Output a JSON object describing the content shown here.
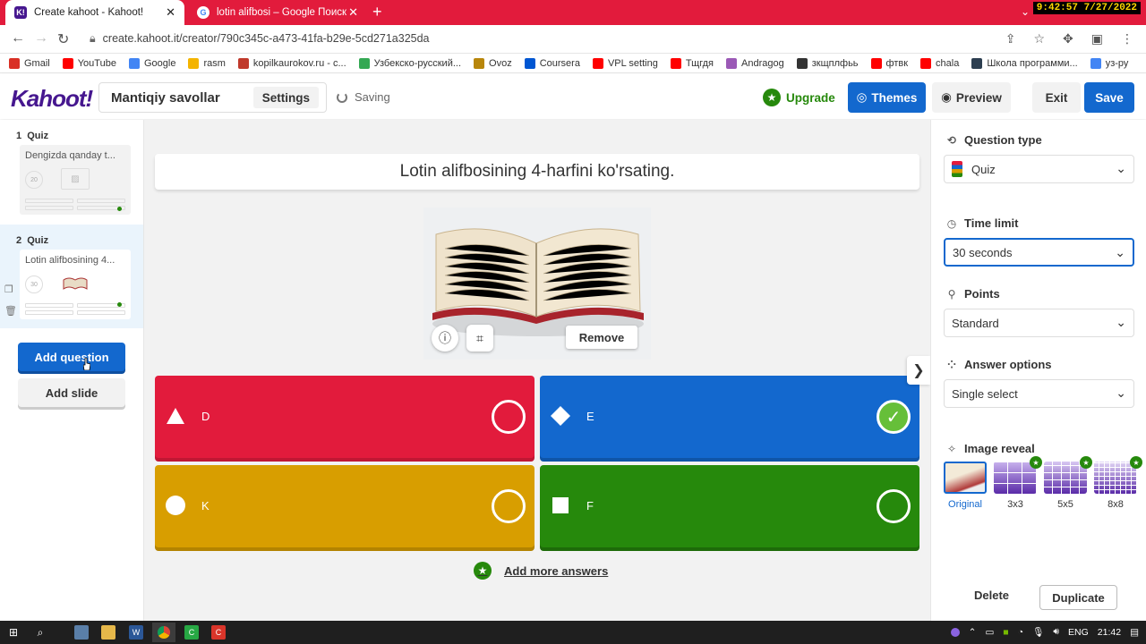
{
  "browser": {
    "tabs": [
      {
        "title": "Create kahoot - Kahoot!",
        "favicon": "K!"
      },
      {
        "title": "lotin alifbosi – Google Поиск",
        "favicon": "G"
      }
    ],
    "clock": "9:42:57  7/27/2022",
    "url": "create.kahoot.it/creator/790c345c-a473-41fa-b29e-5cd271a325da",
    "bookmarks": [
      {
        "label": "Gmail",
        "color": "#d93025"
      },
      {
        "label": "YouTube",
        "color": "#ff0000"
      },
      {
        "label": "Google",
        "color": "#4285f4"
      },
      {
        "label": "rasm",
        "color": "#f4b400"
      },
      {
        "label": "kopilkaurokov.ru - с...",
        "color": "#c0392b"
      },
      {
        "label": "Узбекско-русский...",
        "color": "#34a853"
      },
      {
        "label": "Ovoz",
        "color": "#b8860b"
      },
      {
        "label": "Coursera",
        "color": "#0056d2"
      },
      {
        "label": "VPL setting",
        "color": "#ff0000"
      },
      {
        "label": "Тщгдя",
        "color": "#ff0000"
      },
      {
        "label": "Andragog",
        "color": "#9b59b6"
      },
      {
        "label": "зкщплфьь",
        "color": "#333333"
      },
      {
        "label": "фтвк",
        "color": "#ff0000"
      },
      {
        "label": "chala",
        "color": "#ff0000"
      },
      {
        "label": "Школа программи...",
        "color": "#2c3e50"
      },
      {
        "label": "уз-ру",
        "color": "#4285f4"
      }
    ]
  },
  "header": {
    "logo": "Kahoot!",
    "kahoot_title": "Mantiqiy savollar",
    "settings_label": "Settings",
    "saving_label": "Saving",
    "upgrade_label": "Upgrade",
    "themes_label": "Themes",
    "preview_label": "Preview",
    "exit_label": "Exit",
    "save_label": "Save"
  },
  "sidebar": {
    "slides": [
      {
        "number": "1",
        "type": "Quiz",
        "title": "Dengizda qanday t...",
        "time": "20"
      },
      {
        "number": "2",
        "type": "Quiz",
        "title": "Lotin alifbosining 4...",
        "time": "30"
      }
    ],
    "add_question_label": "Add question",
    "add_slide_label": "Add slide"
  },
  "editor": {
    "question": "Lotin alifbosining 4-harfini ko'rsating.",
    "remove_label": "Remove",
    "answers": [
      {
        "text": "D",
        "color": "#e21b3c",
        "shape": "triangle",
        "correct": false
      },
      {
        "text": "E",
        "color": "#1368ce",
        "shape": "diamond",
        "correct": true
      },
      {
        "text": "K",
        "color": "#d89e00",
        "shape": "circle",
        "correct": false
      },
      {
        "text": "F",
        "color": "#26890c",
        "shape": "square",
        "correct": false
      }
    ],
    "add_more_label": "Add more answers"
  },
  "panel": {
    "question_type_label": "Question type",
    "question_type_value": "Quiz",
    "time_limit_label": "Time limit",
    "time_limit_value": "30 seconds",
    "points_label": "Points",
    "points_value": "Standard",
    "answer_options_label": "Answer options",
    "answer_options_value": "Single select",
    "image_reveal_label": "Image reveal",
    "reveal_options": [
      {
        "label": "Original",
        "selected": true
      },
      {
        "label": "3x3",
        "selected": false
      },
      {
        "label": "5x5",
        "selected": false
      },
      {
        "label": "8x8",
        "selected": false
      }
    ],
    "delete_label": "Delete",
    "duplicate_label": "Duplicate"
  },
  "taskbar": {
    "lang": "ENG",
    "time": "21:42"
  }
}
